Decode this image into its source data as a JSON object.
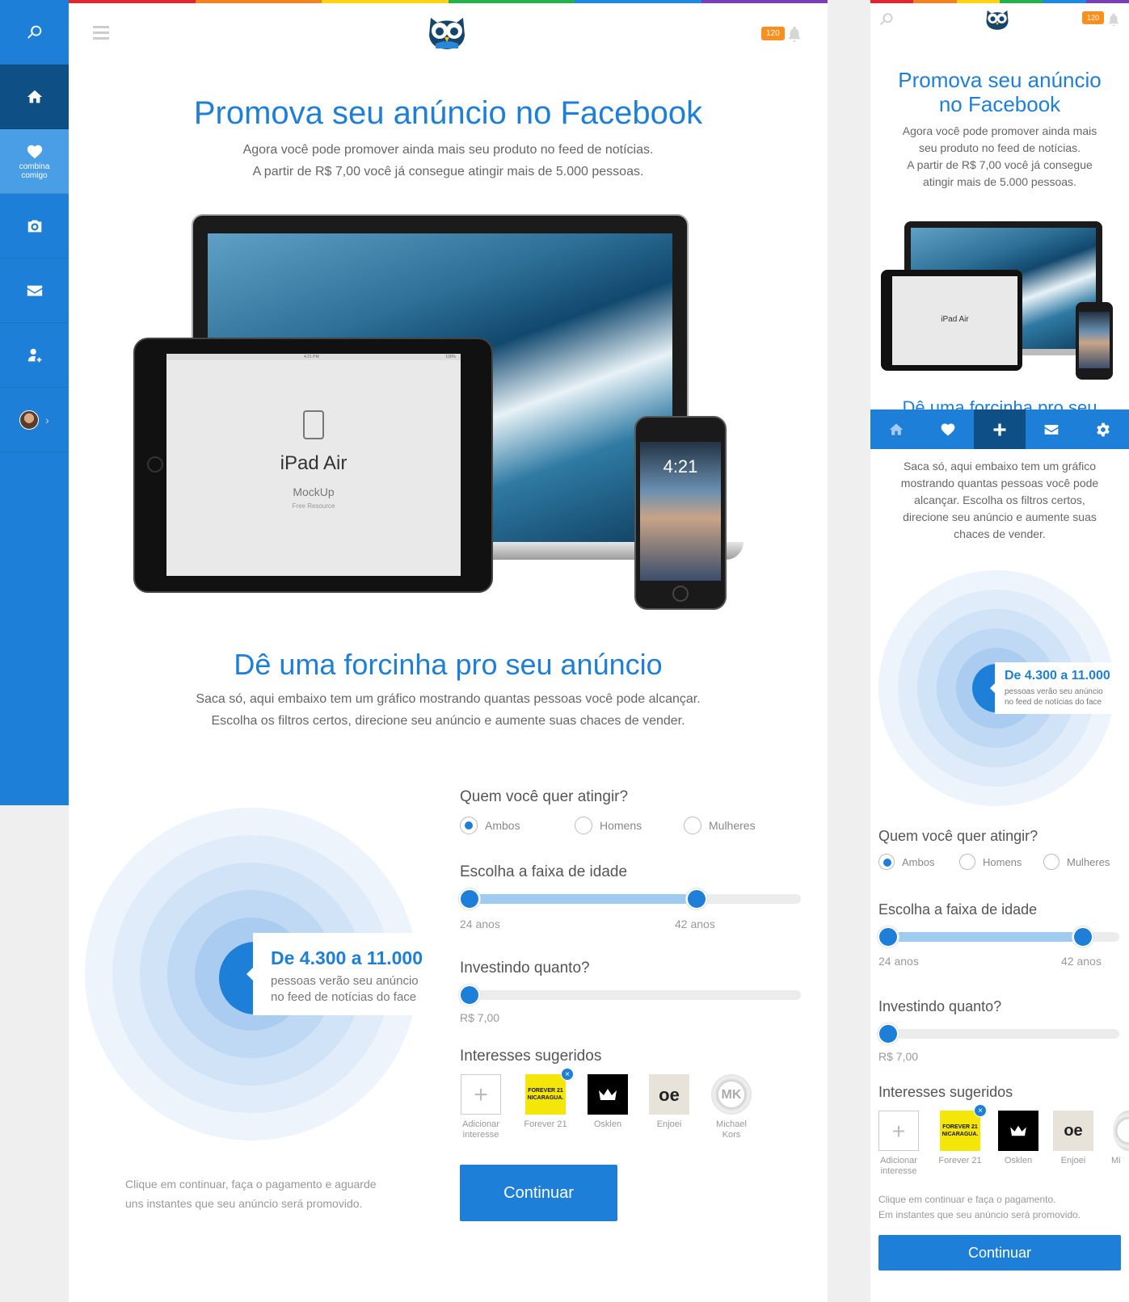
{
  "colors": {
    "accent": "#1e7fd8",
    "sidebar_active": "#0e4f86",
    "notification": "#f7901e",
    "rainbow": [
      "#e2242c",
      "#f58220",
      "#fdd20e",
      "#22b24c",
      "#1e88e5",
      "#7b3fb5"
    ]
  },
  "sidebar": {
    "items": [
      {
        "icon": "search-icon"
      },
      {
        "icon": "home-icon"
      },
      {
        "icon": "heart-icon",
        "label_1": "combina",
        "label_2": "comigo"
      },
      {
        "icon": "camera-icon"
      },
      {
        "icon": "mail-icon"
      },
      {
        "icon": "add-user-icon"
      },
      {
        "icon": "avatar"
      }
    ]
  },
  "header": {
    "notification_count": "120"
  },
  "hero": {
    "title": "Promova seu anúncio no Facebook",
    "subtitle_1": "Agora você pode promover ainda mais seu produto no feed de notícias.",
    "subtitle_2": "A partir de R$ 7,00 você já consegue atingir mais de 5.000 pessoas."
  },
  "mockup": {
    "ipad_title": "iPad Air",
    "ipad_sub": "MockUp",
    "ipad_small": "Free Resource",
    "ipad_time": "4:21 PM",
    "ipad_battery": "100%",
    "iphone_time": "4:21"
  },
  "boost": {
    "title": "Dê uma forcinha pro seu anúncio",
    "subtitle_1": "Saca só, aqui embaixo tem um gráfico mostrando quantas pessoas você pode alcançar.",
    "subtitle_2": "Escolha os filtros certos, direcione seu anúncio e aumente suas chaces de vender."
  },
  "reach": {
    "range": "De 4.300 a 11.000",
    "line_1": "pessoas verão seu anúncio",
    "line_2": "no feed de notícias do face"
  },
  "target": {
    "label": "Quem você quer atingir?",
    "options": [
      "Ambos",
      "Homens",
      "Mulheres"
    ],
    "selected": "Ambos"
  },
  "age": {
    "label": "Escolha a faixa de idade",
    "min": "24 anos",
    "max": "42 anos",
    "range_fill": [
      0,
      0.66
    ]
  },
  "invest": {
    "label": "Investindo quanto?",
    "value": "R$ 7,00",
    "level": 0
  },
  "interests": {
    "label": "Interesses sugeridos",
    "items": [
      {
        "name_1": "Adicionar",
        "name_2": "interesse"
      },
      {
        "name_1": "Forever 21",
        "logo_1": "FOREVER 21",
        "logo_2": "NICARAGUA."
      },
      {
        "name_1": "Osklen"
      },
      {
        "name_1": "Enjoei",
        "logo_1": "oe"
      },
      {
        "name_1": "Michael",
        "name_2": "Kors",
        "logo_1": "MK"
      }
    ]
  },
  "footer": {
    "note_1": "Clique em continuar, faça o pagamento e aguarde",
    "note_2": "uns instantes que seu anúncio será promovido.",
    "button": "Continuar"
  },
  "mobile": {
    "title_1": "Promova seu anúncio",
    "title_2": "no Facebook",
    "sub": [
      "Agora você pode promover ainda mais",
      "seu produto no feed de notícias.",
      "A partir de R$ 7,00 você já consegue",
      "atingir mais de 5.000 pessoas."
    ],
    "boost_title_partial": "Dê uma forcinha pro seu",
    "boost_sub": [
      "Saca só, aqui embaixo tem um gráfico",
      "mostrando quantas pessoas você pode",
      "alcançar. Escolha os filtros certos,",
      "direcione seu anúncio e aumente suas",
      "chaces de vender."
    ],
    "tabs": [
      "home-icon",
      "heart-icon",
      "plus-icon",
      "mail-icon",
      "gear-icon"
    ],
    "note_1": "Clique em continuar e faça o pagamento.",
    "note_2": "Em instantes que seu anúncio será promovido.",
    "button": "Continuar",
    "interest_cut": "Mi"
  }
}
